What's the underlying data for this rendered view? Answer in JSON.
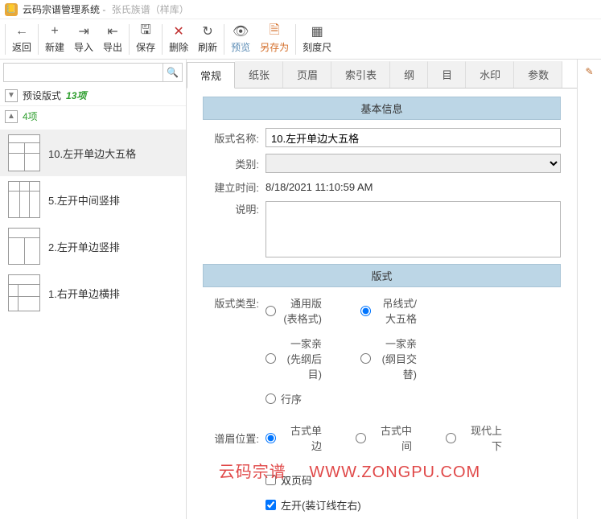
{
  "window": {
    "app_name": "云码宗谱管理系统",
    "doc_name": "张氏族谱（样库）"
  },
  "toolbar": {
    "back": "返回",
    "new": "新建",
    "import": "导入",
    "export": "导出",
    "save": "保存",
    "delete": "删除",
    "refresh": "刷新",
    "preview": "预览",
    "save_as": "另存为",
    "ruler": "刻度尺"
  },
  "sidebar": {
    "search_placeholder": "",
    "section_title": "预设版式",
    "section_count": "13项",
    "sub_count": "4项",
    "items": [
      {
        "label": "10.左开单边大五格"
      },
      {
        "label": "5.左开中间竖排"
      },
      {
        "label": "2.左开单边竖排"
      },
      {
        "label": "1.右开单边横排"
      }
    ]
  },
  "tabs": [
    "常规",
    "纸张",
    "页眉",
    "索引表",
    "纲",
    "目",
    "水印",
    "参数"
  ],
  "form": {
    "section_basic": "基本信息",
    "label_name": "版式名称:",
    "value_name": "10.左开单边大五格",
    "label_category": "类别:",
    "value_category": "",
    "label_created": "建立时间:",
    "value_created": "8/18/2021 11:10:59 AM",
    "label_desc": "说明:",
    "value_desc": "",
    "section_format": "版式",
    "label_type": "版式类型:",
    "radios_type": [
      {
        "label": "通用版(表格式)",
        "checked": false
      },
      {
        "label": "吊线式/大五格",
        "checked": true
      },
      {
        "label": "一家亲(先纲后目)",
        "checked": false
      },
      {
        "label": "一家亲(纲目交替)",
        "checked": false
      },
      {
        "label": "行序",
        "checked": false
      }
    ],
    "label_pos": "谱眉位置:",
    "radios_pos": [
      {
        "label": "古式单边",
        "checked": true
      },
      {
        "label": "古式中间",
        "checked": false
      },
      {
        "label": "现代上下",
        "checked": false
      }
    ],
    "check_dual": {
      "label": "双页码",
      "checked": false
    },
    "check_left": {
      "label": "左开(装订线在右)",
      "checked": true
    }
  },
  "watermark": {
    "text1": "云码宗谱",
    "text2": "WWW.ZONGPU.COM"
  }
}
